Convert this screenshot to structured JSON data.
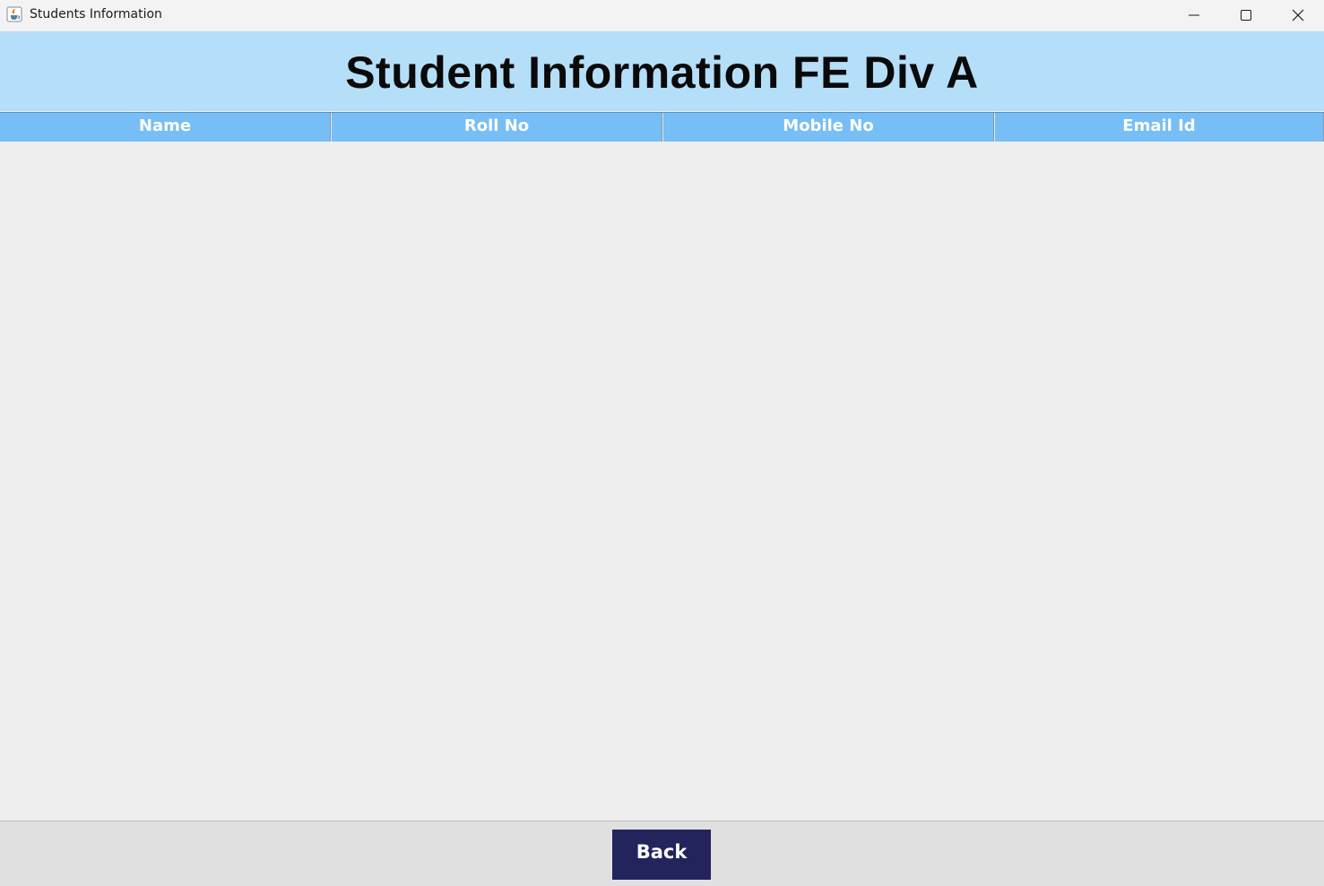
{
  "window": {
    "title": "Students Information",
    "icon": "java-cup-icon"
  },
  "header": {
    "title": "Student Information FE Div A",
    "background": "#b5dff8"
  },
  "table": {
    "columns": [
      "Name",
      "Roll No",
      "Mobile No",
      "Email Id"
    ],
    "header_background": "#76bef5",
    "rows": []
  },
  "footer": {
    "back_label": "Back",
    "back_color": "#23245c"
  }
}
